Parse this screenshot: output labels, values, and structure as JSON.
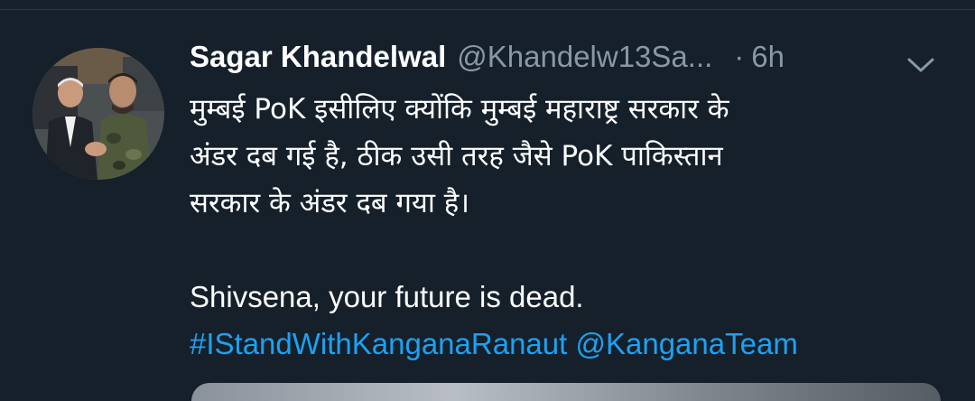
{
  "tweet": {
    "author_name": "Sagar Khandelwal",
    "author_handle": "@Khandelw13Sa...",
    "separator": "·",
    "time": "6h",
    "text_hindi_line1": "मुम्बई PoK इसीलिए क्योंकि मुम्बई महाराष्ट्र सरकार के",
    "text_hindi_line2": "अंडर दब गई है, ठीक उसी तरह जैसे PoK पाकिस्तान",
    "text_hindi_line3": "सरकार के अंडर दब गया है।",
    "text_english": "Shivsena, your future is dead.",
    "hashtag": "#IStandWithKanganaRanaut",
    "mention": "@KanganaTeam"
  },
  "icons": {
    "more_menu": "chevron-down-icon",
    "avatar": "profile-photo"
  },
  "colors": {
    "background": "#15202b",
    "secondary_text": "#8899a6",
    "link": "#1da1f2"
  }
}
